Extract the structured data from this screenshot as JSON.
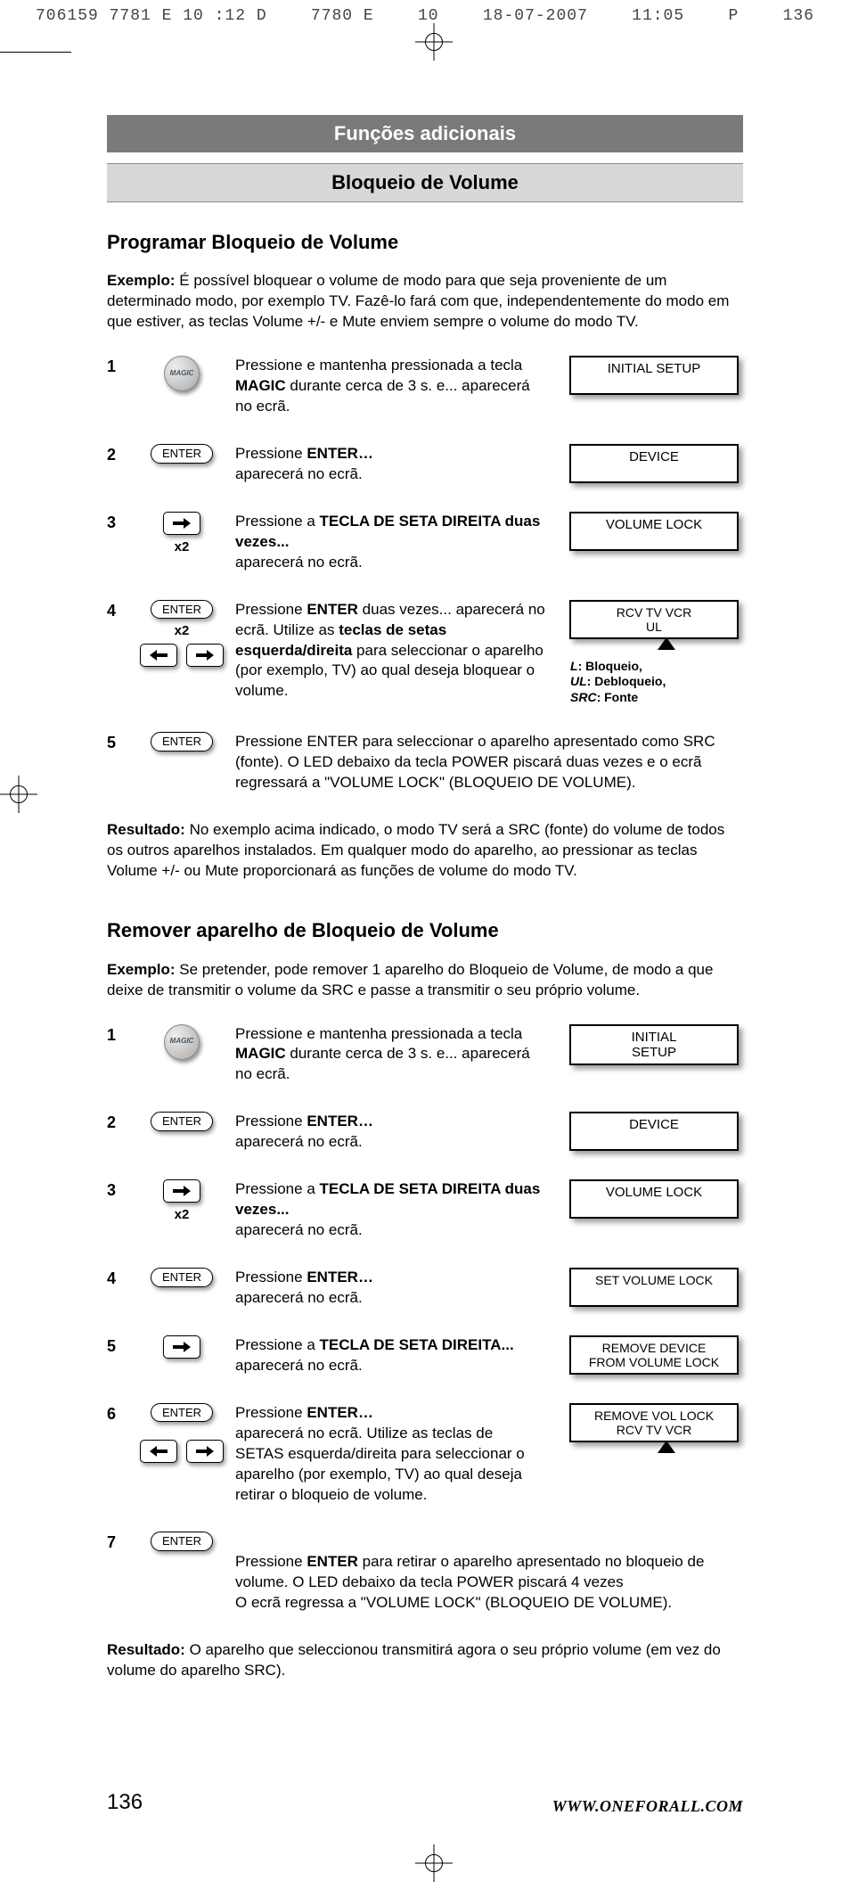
{
  "crop": {
    "left": "706159 7781 E 10 :12 D",
    "mid1": "7780 E",
    "mid2": "10",
    "date": "18-07-2007",
    "time": "11:05",
    "p": "P",
    "page": "136"
  },
  "banners": {
    "dark": "Funções adicionais",
    "light": "Bloqueio de Volume"
  },
  "sectionA": {
    "title": "Programar Bloqueio de Volume",
    "introLabel": "Exemplo:",
    "intro": " É possível bloquear o volume de modo para que seja proveniente de um determinado modo, por exemplo TV.  Fazê-lo fará com que, independentemente do modo em que estiver, as teclas Volume +/- e Mute enviem sempre o volume do modo TV.",
    "steps": {
      "1": {
        "num": "1",
        "text_a": "Pressione e mantenha pressionada a tecla ",
        "text_bold": "MAGIC",
        "text_b": " durante cerca de 3 s. e... aparecerá no ecrã.",
        "lcd": "INITIAL\nSETUP"
      },
      "2": {
        "num": "2",
        "text_a": "Pressione ",
        "text_bold": "ENTER…",
        "text_b": "\naparecerá no ecrã.",
        "lcd": "DEVICE"
      },
      "3": {
        "num": "3",
        "text_a": "Pressione a ",
        "text_bold": "TECLA DE SETA DIREITA duas vezes...",
        "text_b": "\naparecerá no ecrã.",
        "lcd": "VOLUME LOCK"
      },
      "4": {
        "num": "4",
        "text_a": "Pressione ",
        "text_bold": "ENTER",
        "text_mid": " duas vezes... aparecerá no ecrã. Utilize as ",
        "text_bold2": "teclas de setas esquerda/direita",
        "text_b": " para seleccionar o aparelho (por exemplo, TV) ao qual deseja bloquear o volume.",
        "lcd": "RCV   TV   VCR\nUL"
      },
      "5": {
        "num": "5",
        "text": "Pressione ENTER para seleccionar o aparelho apresentado como SRC (fonte). O LED debaixo da tecla POWER piscará duas vezes e o ecrã regressará a \"VOLUME LOCK\" (BLOQUEIO DE VOLUME)."
      }
    },
    "legend": {
      "l1": "L",
      "l1t": ": Bloqueio,",
      "l2": "UL",
      "l2t": ": Debloqueio,",
      "l3": "SRC",
      "l3t": ": Fonte"
    },
    "resultLabel": "Resultado:",
    "result": " No exemplo acima indicado, o modo TV será a SRC (fonte) do volume de todos os outros aparelhos instalados. Em qualquer modo do aparelho, ao pressionar as teclas Volume +/- ou Mute proporcionará as funções de volume do modo TV."
  },
  "sectionB": {
    "title": "Remover aparelho de Bloqueio de Volume",
    "introLabel": "Exemplo:",
    "intro": " Se pretender, pode remover 1 aparelho do Bloqueio de Volume, de modo a que deixe de transmitir o volume da SRC e passe a transmitir o seu próprio volume.",
    "steps": {
      "1": {
        "num": "1",
        "text_a": "Pressione e mantenha pressionada a tecla ",
        "text_bold": "MAGIC",
        "text_b": " durante cerca de 3 s. e... aparecerá no ecrã.",
        "lcd": "INITIAL\nSETUP"
      },
      "2": {
        "num": "2",
        "text_a": "Pressione ",
        "text_bold": "ENTER…",
        "text_b": "\naparecerá no ecrã.",
        "lcd": "DEVICE"
      },
      "3": {
        "num": "3",
        "text_a": "Pressione a ",
        "text_bold": "TECLA DE SETA DIREITA duas vezes...",
        "text_b": "\naparecerá no ecrã.",
        "lcd": "VOLUME LOCK"
      },
      "4": {
        "num": "4",
        "text_a": "Pressione ",
        "text_bold": "ENTER…",
        "text_b": "\naparecerá no ecrã.",
        "lcd": "SET VOLUME LOCK"
      },
      "5": {
        "num": "5",
        "text_a": "Pressione a ",
        "text_bold": "TECLA DE SETA DIREITA...",
        "text_b": "\naparecerá no ecrã.",
        "lcd": "REMOVE DEVICE\nFROM VOLUME LOCK"
      },
      "6": {
        "num": "6",
        "text_a": "Pressione ",
        "text_bold": "ENTER…",
        "text_b": "\naparecerá no ecrã. Utilize as teclas de SETAS esquerda/direita para seleccionar o aparelho (por exemplo, TV) ao qual deseja retirar o bloqueio de volume.",
        "lcd": "REMOVE VOL LOCK\nRCV    TV   VCR"
      },
      "7": {
        "num": "7",
        "text_a": "Pressione ",
        "text_bold": "ENTER",
        "text_b": " para retirar o aparelho apresentado no bloqueio de volume. O LED debaixo da tecla POWER piscará 4 vezes\nO ecrã regressa a \"VOLUME LOCK\" (BLOQUEIO DE VOLUME)."
      }
    },
    "resultLabel": "Resultado:",
    "result": " O aparelho que seleccionou transmitirá agora o seu próprio volume (em vez do volume do aparelho SRC)."
  },
  "buttons": {
    "enter": "ENTER",
    "magic": "MAGIC",
    "x2": "x2"
  },
  "footer": {
    "page": "136",
    "url": "WWW.ONEFORALL.COM"
  }
}
